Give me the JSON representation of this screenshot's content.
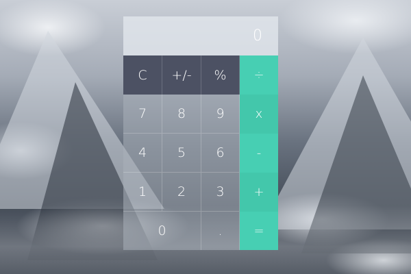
{
  "display": {
    "value": "0"
  },
  "function_keys": [
    {
      "label": "C"
    },
    {
      "label": "+/-"
    },
    {
      "label": "%"
    }
  ],
  "operator_keys": [
    {
      "label": "÷"
    },
    {
      "label": "x"
    },
    {
      "label": "-"
    },
    {
      "label": "+"
    },
    {
      "label": "="
    }
  ],
  "number_rows": [
    [
      {
        "label": "7"
      },
      {
        "label": "8"
      },
      {
        "label": "9"
      }
    ],
    [
      {
        "label": "4"
      },
      {
        "label": "5"
      },
      {
        "label": "6"
      }
    ],
    [
      {
        "label": "1"
      },
      {
        "label": "2"
      },
      {
        "label": "3"
      }
    ]
  ],
  "bottom_row": [
    {
      "label": "0"
    },
    {
      "label": "."
    }
  ],
  "colors": {
    "accent": "#47cfb3",
    "function_key": "#4c5163"
  }
}
